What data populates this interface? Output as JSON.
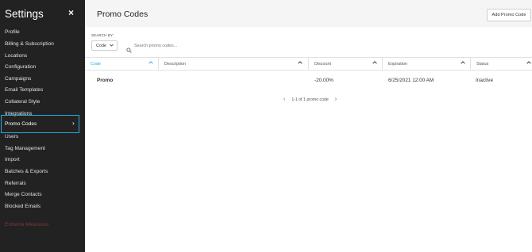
{
  "sidebar": {
    "title": "Settings",
    "close": "×",
    "items": [
      {
        "label": "Profile"
      },
      {
        "label": "Billing & Subscription"
      },
      {
        "label": "Locations"
      },
      {
        "label": "Configuration"
      },
      {
        "label": "Campaigns"
      },
      {
        "label": "Email Templates"
      },
      {
        "label": "Collateral Style"
      },
      {
        "label": "Integrations"
      },
      {
        "label": "Promo Codes",
        "active": true,
        "chevron": "›"
      },
      {
        "label": "Users"
      },
      {
        "label": "Tag Management"
      },
      {
        "label": "Import"
      },
      {
        "label": "Batches & Exports"
      },
      {
        "label": "Referrals"
      },
      {
        "label": "Merge Contacts"
      },
      {
        "label": "Blocked Emails"
      }
    ],
    "danger_item": "Extreme Measures",
    "accent_color": "#2aa9e0"
  },
  "header": {
    "title": "Promo Codes",
    "add_button": "Add Promo Code"
  },
  "search": {
    "label": "SEARCH BY:",
    "select_value": "Code",
    "placeholder": "Search promo codes...",
    "value": ""
  },
  "table": {
    "columns": [
      "Code",
      "Description",
      "Discount",
      "Expiration",
      "Status"
    ],
    "rows": [
      {
        "code": "Promo",
        "description": "",
        "discount": "-20.00%",
        "expiration": "6/25/2021 12:00 AM",
        "status": "Inactive"
      }
    ]
  },
  "pagination": {
    "prev": "‹",
    "text": "1-1 of 1 promo code",
    "next": "›"
  }
}
